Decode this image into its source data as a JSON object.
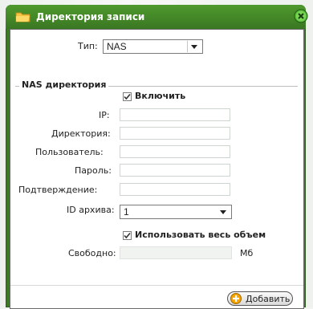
{
  "window": {
    "title": "Директория записи",
    "colors": {
      "titlebar": "#3d7a24",
      "accent_plus": "#f5a400"
    }
  },
  "type_row": {
    "label": "Тип:",
    "selected": "NAS"
  },
  "nas_group": {
    "title": "NAS директория",
    "enable": {
      "label": "Включить",
      "checked": true
    },
    "fields": [
      {
        "label": "IP:",
        "value": ""
      },
      {
        "label": "Директория:",
        "value": ""
      },
      {
        "label": "Пользователь:",
        "value": ""
      },
      {
        "label": "Пароль:",
        "value": ""
      },
      {
        "label": "Подтверждение:",
        "value": ""
      }
    ],
    "archive_id": {
      "label": "ID архива:",
      "selected": "1"
    },
    "use_all": {
      "label": "Использовать весь объем",
      "checked": true
    },
    "free": {
      "label": "Свободно:",
      "value": "",
      "unit": "Мб"
    }
  },
  "footer": {
    "add_label": "Добавить"
  }
}
